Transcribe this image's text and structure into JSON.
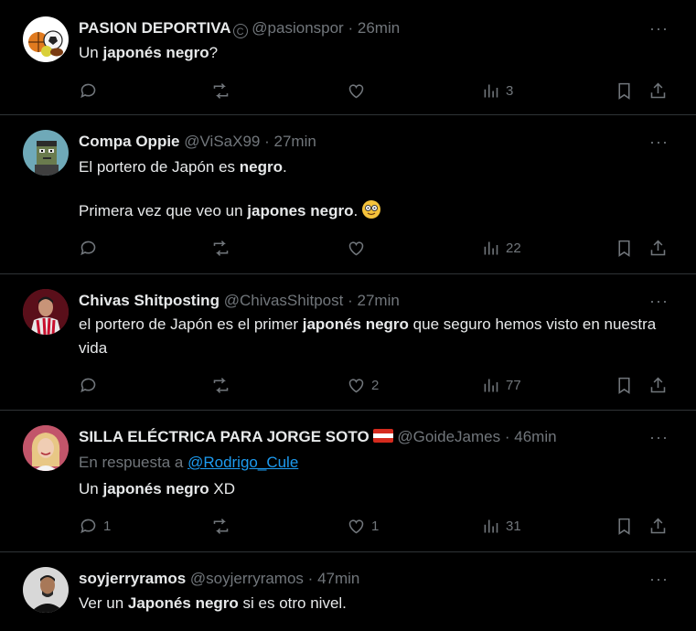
{
  "tweets": [
    {
      "name": "PASION DEPORTIVA",
      "handle": "@pasionspor",
      "time": "26min",
      "body_pre": "Un ",
      "body_bold": "japonés negro",
      "body_post": "?",
      "replies": "",
      "retweets": "",
      "likes": "",
      "views": "3"
    },
    {
      "name": "Compa Oppie",
      "handle": "@ViSaX99",
      "time": "27min",
      "line1_pre": "El portero de Japón es ",
      "line1_bold": "negro",
      "line1_post": ".",
      "line2_pre": "Primera vez que veo un ",
      "line2_bold": "japones negro",
      "line2_post": ".",
      "replies": "",
      "retweets": "",
      "likes": "",
      "views": "22"
    },
    {
      "name": "Chivas Shitposting",
      "handle": "@ChivasShitpost",
      "time": "27min",
      "body_pre": "el portero de Japón es el primer ",
      "body_bold": "japonés negro",
      "body_post": " que seguro hemos visto en nuestra vida",
      "replies": "",
      "retweets": "",
      "likes": "2",
      "views": "77"
    },
    {
      "name": "SILLA ELÉCTRICA PARA JORGE SOTO",
      "handle": "@GoideJames",
      "time": "46min",
      "reply_label": "En respuesta a ",
      "reply_to": "@Rodrigo_Cule",
      "body_pre": "Un ",
      "body_bold": "japonés negro",
      "body_post": " XD",
      "replies": "1",
      "retweets": "",
      "likes": "1",
      "views": "31"
    },
    {
      "name": "soyjerryramos",
      "handle": "@soyjerryramos",
      "time": "47min",
      "body_pre": "Ver un ",
      "body_bold": "Japonés negro",
      "body_post": " si es otro nivel."
    }
  ],
  "separator": "·",
  "more_glyph": "···",
  "colors": {
    "background": "#000000",
    "text": "#e7e9ea",
    "muted": "#71767b",
    "link": "#1d9bf0",
    "divider": "#2f3336"
  },
  "icons": [
    "reply-icon",
    "retweet-icon",
    "like-icon",
    "views-icon",
    "bookmark-icon",
    "share-icon",
    "more-icon"
  ]
}
